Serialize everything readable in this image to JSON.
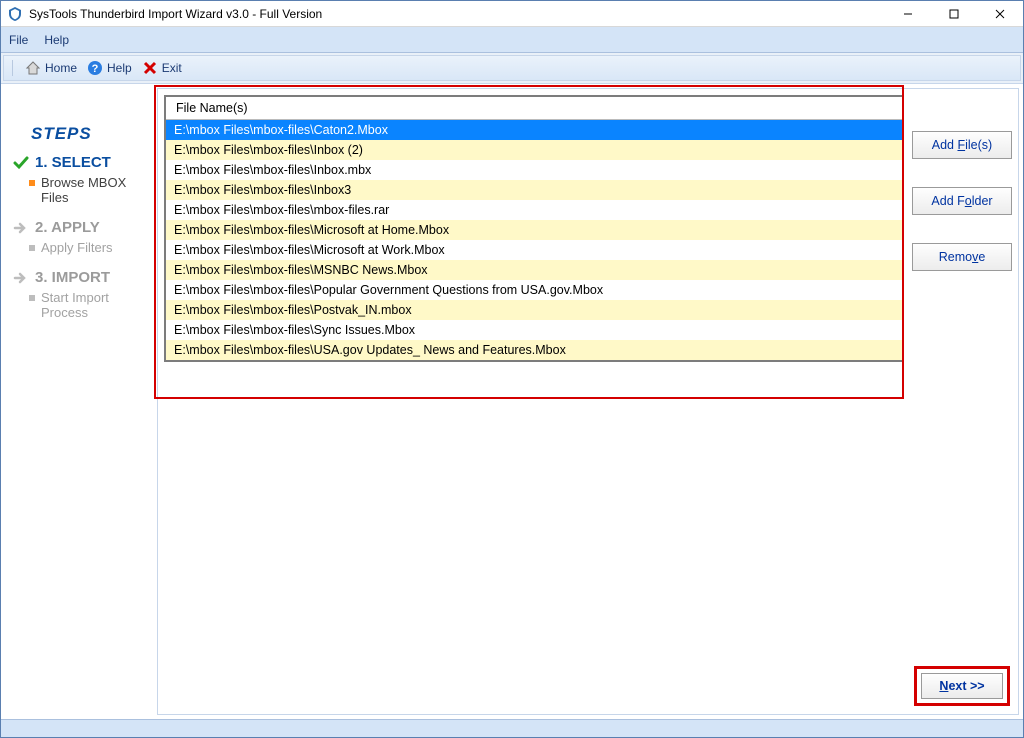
{
  "window": {
    "title": "SysTools Thunderbird Import Wizard v3.0 - Full Version"
  },
  "menubar": {
    "file": "File",
    "help": "Help"
  },
  "toolbar": {
    "home": "Home",
    "help": "Help",
    "exit": "Exit"
  },
  "steps": {
    "title": "STEPS",
    "s1": {
      "label": "1. SELECT",
      "sub": "Browse MBOX Files"
    },
    "s2": {
      "label": "2. APPLY",
      "sub": "Apply Filters"
    },
    "s3": {
      "label": "3. IMPORT",
      "sub": "Start Import Process"
    }
  },
  "filelist": {
    "header": "File Name(s)",
    "rows": [
      "E:\\mbox Files\\mbox-files\\Caton2.Mbox",
      "E:\\mbox Files\\mbox-files\\Inbox (2)",
      "E:\\mbox Files\\mbox-files\\Inbox.mbx",
      "E:\\mbox Files\\mbox-files\\Inbox3",
      "E:\\mbox Files\\mbox-files\\mbox-files.rar",
      "E:\\mbox Files\\mbox-files\\Microsoft at Home.Mbox",
      "E:\\mbox Files\\mbox-files\\Microsoft at Work.Mbox",
      "E:\\mbox Files\\mbox-files\\MSNBC News.Mbox",
      "E:\\mbox Files\\mbox-files\\Popular Government Questions from USA.gov.Mbox",
      "E:\\mbox Files\\mbox-files\\Postvak_IN.mbox",
      "E:\\mbox Files\\mbox-files\\Sync Issues.Mbox",
      "E:\\mbox Files\\mbox-files\\USA.gov Updates_ News and Features.Mbox"
    ]
  },
  "buttons": {
    "add_files_prefix": "Add ",
    "add_files_ul": "F",
    "add_files_suffix": "ile(s)",
    "add_folder_prefix": "Add F",
    "add_folder_ul": "o",
    "add_folder_suffix": "lder",
    "remove_prefix": "Remo",
    "remove_ul": "v",
    "remove_suffix": "e",
    "next_ul": "N",
    "next_suffix": "ext >>"
  }
}
